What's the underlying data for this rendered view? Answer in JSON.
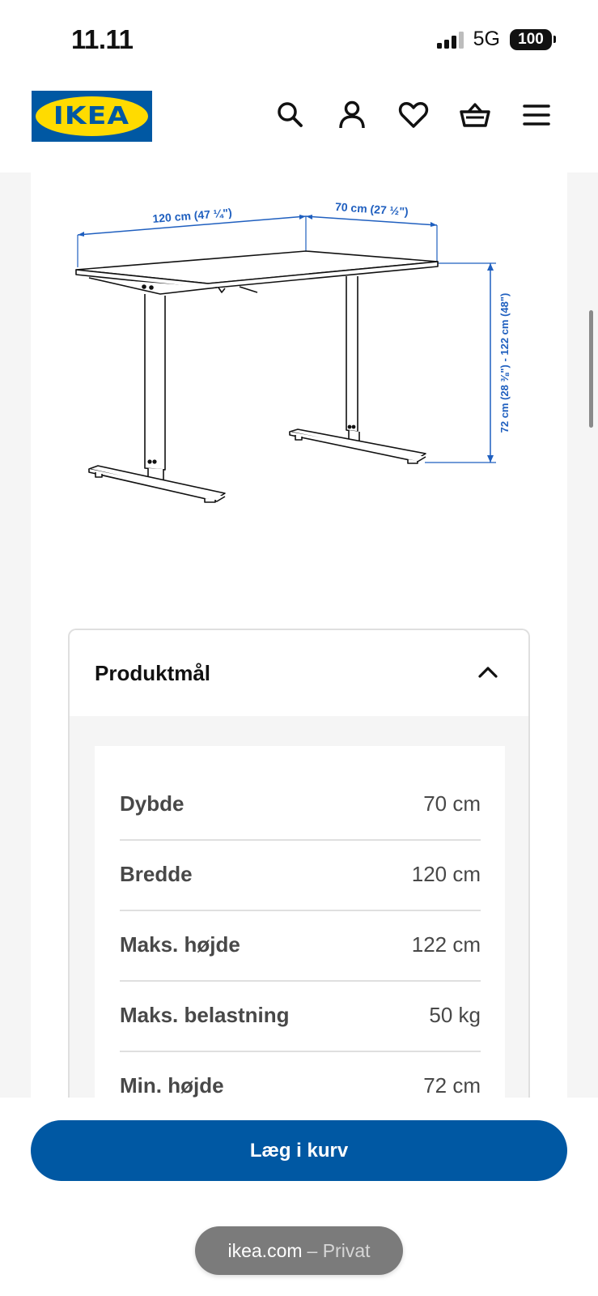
{
  "status_bar": {
    "time": "11.11",
    "network": "5G",
    "battery": "100"
  },
  "header": {
    "logo_text": "IKEA",
    "icons": [
      "search-icon",
      "account-icon",
      "heart-icon",
      "basket-icon",
      "menu-icon"
    ]
  },
  "diagram": {
    "width_label": "120 cm (47 ¼\")",
    "depth_label": "70 cm (27 ½\")",
    "height_label": "72 cm (28 ⅜\") - 122 cm (48\")"
  },
  "dimensions": {
    "title": "Produktmål",
    "rows": [
      {
        "label": "Dybde",
        "value": "70 cm"
      },
      {
        "label": "Bredde",
        "value": "120 cm"
      },
      {
        "label": "Maks. højde",
        "value": "122 cm"
      },
      {
        "label": "Maks. belastning",
        "value": "50 kg"
      },
      {
        "label": "Min. højde",
        "value": "72 cm"
      }
    ]
  },
  "bottom": {
    "cart_button_label": "Læg i kurv",
    "url_domain": "ikea.com",
    "url_mode": "– Privat"
  },
  "colors": {
    "brand_blue": "#0058a3",
    "brand_yellow": "#ffdb00",
    "dimension_blue": "#1f5fbf"
  }
}
